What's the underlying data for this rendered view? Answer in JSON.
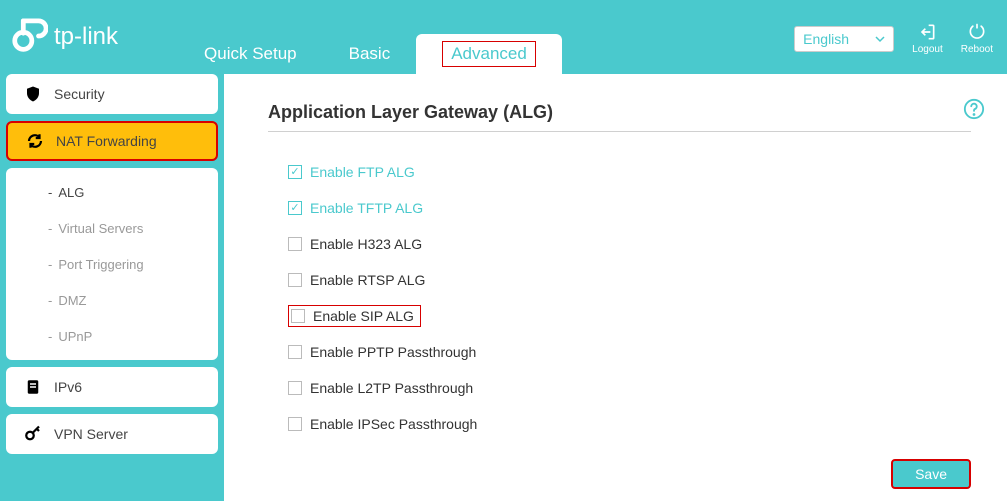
{
  "brand": "tp-link",
  "tabs": {
    "quick": "Quick Setup",
    "basic": "Basic",
    "advanced": "Advanced"
  },
  "language": "English",
  "top_buttons": {
    "logout": "Logout",
    "reboot": "Reboot"
  },
  "sidebar": {
    "security": "Security",
    "nat": "NAT Forwarding",
    "ipv6": "IPv6",
    "vpn": "VPN Server",
    "sub": {
      "alg": "ALG",
      "vs": "Virtual Servers",
      "pt": "Port Triggering",
      "dmz": "DMZ",
      "upnp": "UPnP"
    }
  },
  "main": {
    "title": "Application Layer Gateway (ALG)",
    "save": "Save",
    "options": {
      "ftp": {
        "label": "Enable FTP ALG",
        "checked": true
      },
      "tftp": {
        "label": "Enable TFTP ALG",
        "checked": true
      },
      "h323": {
        "label": "Enable H323 ALG",
        "checked": false
      },
      "rtsp": {
        "label": "Enable RTSP ALG",
        "checked": false
      },
      "sip": {
        "label": "Enable SIP ALG",
        "checked": false
      },
      "pptp": {
        "label": "Enable PPTP Passthrough",
        "checked": false
      },
      "l2tp": {
        "label": "Enable L2TP Passthrough",
        "checked": false
      },
      "ipsec": {
        "label": "Enable IPSec Passthrough",
        "checked": false
      }
    }
  }
}
